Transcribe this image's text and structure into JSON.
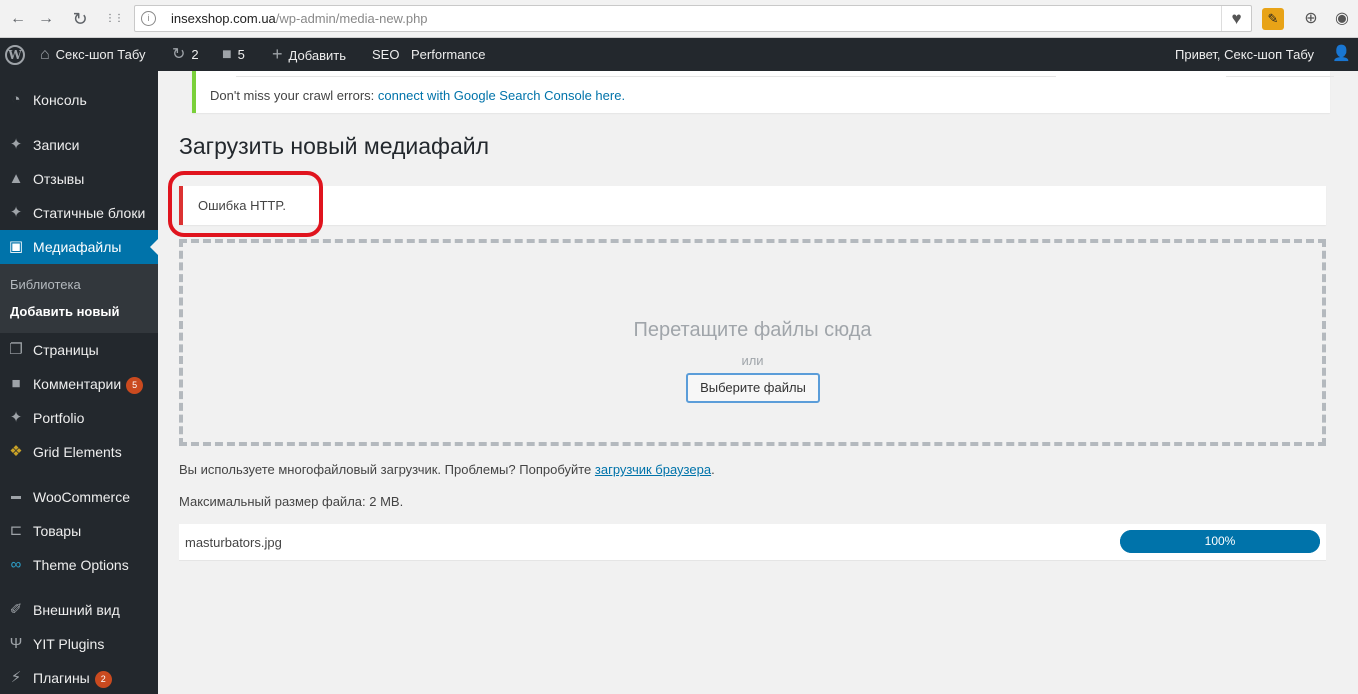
{
  "browser": {
    "back": "←",
    "forward": "→",
    "reload": "↻",
    "apps": "⋮⋮",
    "url_host": "insexshop.com.ua",
    "url_path": "/wp-admin/media-new.php",
    "bookmark": "♥",
    "icons": [
      "extension-icon",
      "download-icon",
      "account-icon"
    ]
  },
  "adminbar": {
    "site_name": "Секс-шоп Табу",
    "updates_count": "2",
    "comments_count": "5",
    "add_new": "Добавить",
    "seo": "SEO",
    "performance": "Performance",
    "greeting": "Привет, Секс-шоп Табу"
  },
  "sidebar": {
    "items": [
      {
        "label": "Консоль",
        "icon": "dashboard-icon"
      },
      {
        "label": "Записи",
        "icon": "pin-icon"
      },
      {
        "label": "Отзывы",
        "icon": "thumbs-up-icon"
      },
      {
        "label": "Статичные блоки",
        "icon": "pin-icon"
      },
      {
        "label": "Медиафайлы",
        "icon": "media-icon"
      },
      {
        "label": "Страницы",
        "icon": "pages-icon"
      },
      {
        "label": "Комментарии",
        "icon": "comment-icon",
        "badge": "5"
      },
      {
        "label": "Portfolio",
        "icon": "pin-icon"
      },
      {
        "label": "Grid Elements",
        "icon": "grid-icon"
      },
      {
        "label": "WooCommerce",
        "icon": "woo-icon"
      },
      {
        "label": "Товары",
        "icon": "cart-icon"
      },
      {
        "label": "Theme Options",
        "icon": "infinity-icon"
      },
      {
        "label": "Внешний вид",
        "icon": "brush-icon"
      },
      {
        "label": "YIT Plugins",
        "icon": "plugins-icon"
      },
      {
        "label": "Плагины",
        "icon": "plug-icon",
        "badge": "2"
      }
    ],
    "submenu": {
      "library": "Библиотека",
      "add_new": "Добавить новый"
    }
  },
  "notice": {
    "text": "Don't miss your crawl errors: ",
    "link": "connect with Google Search Console here."
  },
  "page": {
    "title": "Загрузить новый медиафайл",
    "error": "Ошибка HTTP.",
    "drop_title": "Перетащите файлы сюда",
    "drop_or": "или",
    "select_button": "Выберите файлы",
    "uploader_info": "Вы используете многофайловый загрузчик. Проблемы? Попробуйте ",
    "uploader_link": "загрузчик браузера",
    "uploader_end": ".",
    "max_size": "Максимальный размер файла: 2 MB."
  },
  "upload": {
    "filename": "masturbators.jpg",
    "progress": 1.0,
    "progress_label": "100%"
  },
  "colors": {
    "accent": "#0073aa",
    "error": "#dc3232",
    "highlight": "#e0141e",
    "notice_ok": "#7ad03a",
    "admin_dark": "#23282d"
  }
}
